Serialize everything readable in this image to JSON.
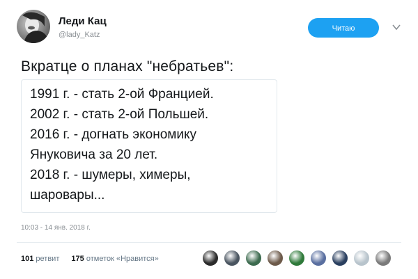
{
  "author": {
    "display_name": "Леди Кац",
    "handle": "@lady_Katz",
    "avatar_icon": "avatar-photo"
  },
  "follow_button": {
    "label": "Читаю",
    "color": "#1da1f2"
  },
  "menu_icon": "chevron-down-icon",
  "tweet": {
    "text": "Вкратце о планах \"небратьев\":",
    "quote_lines": [
      "1991 г. - стать 2-ой Францией.",
      "2002 г. - стать 2-ой Польшей.",
      "2016 г. - догнать экономику",
      "Януковича за 20 лет.",
      "2018 г. - шумеры, химеры,",
      "шаровары..."
    ],
    "timestamp": "10:03 - 14 янв. 2018 г."
  },
  "stats": {
    "retweets_count": "101",
    "retweets_label": "ретвит",
    "likes_count": "175",
    "likes_label": "отметок «Нравится»"
  },
  "likers": [
    {
      "name": "liker-avatar-1",
      "color": "#2b2b2b"
    },
    {
      "name": "liker-avatar-2",
      "color": "#4a5560"
    },
    {
      "name": "liker-avatar-3",
      "color": "#3d6b4f"
    },
    {
      "name": "liker-avatar-4",
      "color": "#6d5a4a"
    },
    {
      "name": "liker-avatar-5",
      "color": "#2f7a3a"
    },
    {
      "name": "liker-avatar-6",
      "color": "#5a6fa0"
    },
    {
      "name": "liker-avatar-7",
      "color": "#2a3f5f"
    },
    {
      "name": "liker-avatar-8",
      "color": "#b8c4cc"
    },
    {
      "name": "liker-avatar-9",
      "color": "#7a7a7a"
    }
  ]
}
